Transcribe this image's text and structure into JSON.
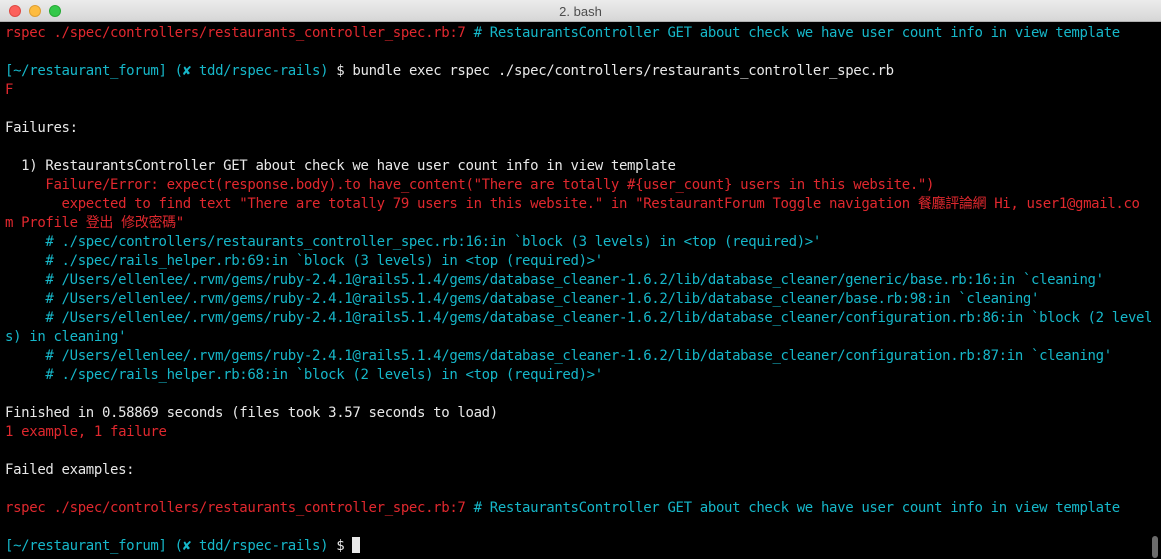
{
  "window": {
    "title": "2. bash"
  },
  "terminal": {
    "lines": [
      [
        [
          "rspec ./spec/controllers/restaurants_controller_spec.rb:7",
          "red"
        ],
        [
          " # RestaurantsController GET about check we have user count info in view template",
          "cyan"
        ]
      ],
      [],
      [
        [
          "[~/restaurant_forum]",
          "cyan"
        ],
        [
          " ",
          "white"
        ],
        [
          "(✘ tdd/rspec-rails)",
          "cyan"
        ],
        [
          " $ bundle exec rspec ./spec/controllers/restaurants_controller_spec.rb",
          "white"
        ]
      ],
      [
        [
          "F",
          "red"
        ]
      ],
      [],
      [
        [
          "Failures:",
          "white"
        ]
      ],
      [],
      [
        [
          "  1) RestaurantsController GET about check we have user count info in view template",
          "white"
        ]
      ],
      [
        [
          "     Failure/Error: expect(response.body).to have_content(\"There are totally #{user_count} users in this website.\")",
          "red"
        ]
      ],
      [
        [
          "       expected to find text \"There are totally 79 users in this website.\" in \"RestaurantForum Toggle navigation 餐廳評論網 Hi, user1@gmail.co",
          "red"
        ]
      ],
      [
        [
          "m Profile 登出 修改密碼\"",
          "red"
        ]
      ],
      [
        [
          "     # ./spec/controllers/restaurants_controller_spec.rb:16:in `block (3 levels) in <top (required)>'",
          "cyan"
        ]
      ],
      [
        [
          "     # ./spec/rails_helper.rb:69:in `block (3 levels) in <top (required)>'",
          "cyan"
        ]
      ],
      [
        [
          "     # /Users/ellenlee/.rvm/gems/ruby-2.4.1@rails5.1.4/gems/database_cleaner-1.6.2/lib/database_cleaner/generic/base.rb:16:in `cleaning'",
          "cyan"
        ]
      ],
      [
        [
          "     # /Users/ellenlee/.rvm/gems/ruby-2.4.1@rails5.1.4/gems/database_cleaner-1.6.2/lib/database_cleaner/base.rb:98:in `cleaning'",
          "cyan"
        ]
      ],
      [
        [
          "     # /Users/ellenlee/.rvm/gems/ruby-2.4.1@rails5.1.4/gems/database_cleaner-1.6.2/lib/database_cleaner/configuration.rb:86:in `block (2 level",
          "cyan"
        ]
      ],
      [
        [
          "s) in cleaning'",
          "cyan"
        ]
      ],
      [
        [
          "     # /Users/ellenlee/.rvm/gems/ruby-2.4.1@rails5.1.4/gems/database_cleaner-1.6.2/lib/database_cleaner/configuration.rb:87:in `cleaning'",
          "cyan"
        ]
      ],
      [
        [
          "     # ./spec/rails_helper.rb:68:in `block (2 levels) in <top (required)>'",
          "cyan"
        ]
      ],
      [],
      [
        [
          "Finished in 0.58869 seconds (files took 3.57 seconds to load)",
          "white"
        ]
      ],
      [
        [
          "1 example, 1 failure",
          "red"
        ]
      ],
      [],
      [
        [
          "Failed examples:",
          "white"
        ]
      ],
      [],
      [
        [
          "rspec ./spec/controllers/restaurants_controller_spec.rb:7",
          "red"
        ],
        [
          " # RestaurantsController GET about check we have user count info in view template",
          "cyan"
        ]
      ],
      [],
      [
        [
          "[~/restaurant_forum]",
          "cyan"
        ],
        [
          " ",
          "white"
        ],
        [
          "(✘ tdd/rspec-rails)",
          "cyan"
        ],
        [
          " $ ",
          "white"
        ]
      ]
    ]
  },
  "colors": {
    "red": "#e0282e",
    "cyan": "#16b7c9",
    "white": "#e8e8e8",
    "background": "#000000"
  }
}
